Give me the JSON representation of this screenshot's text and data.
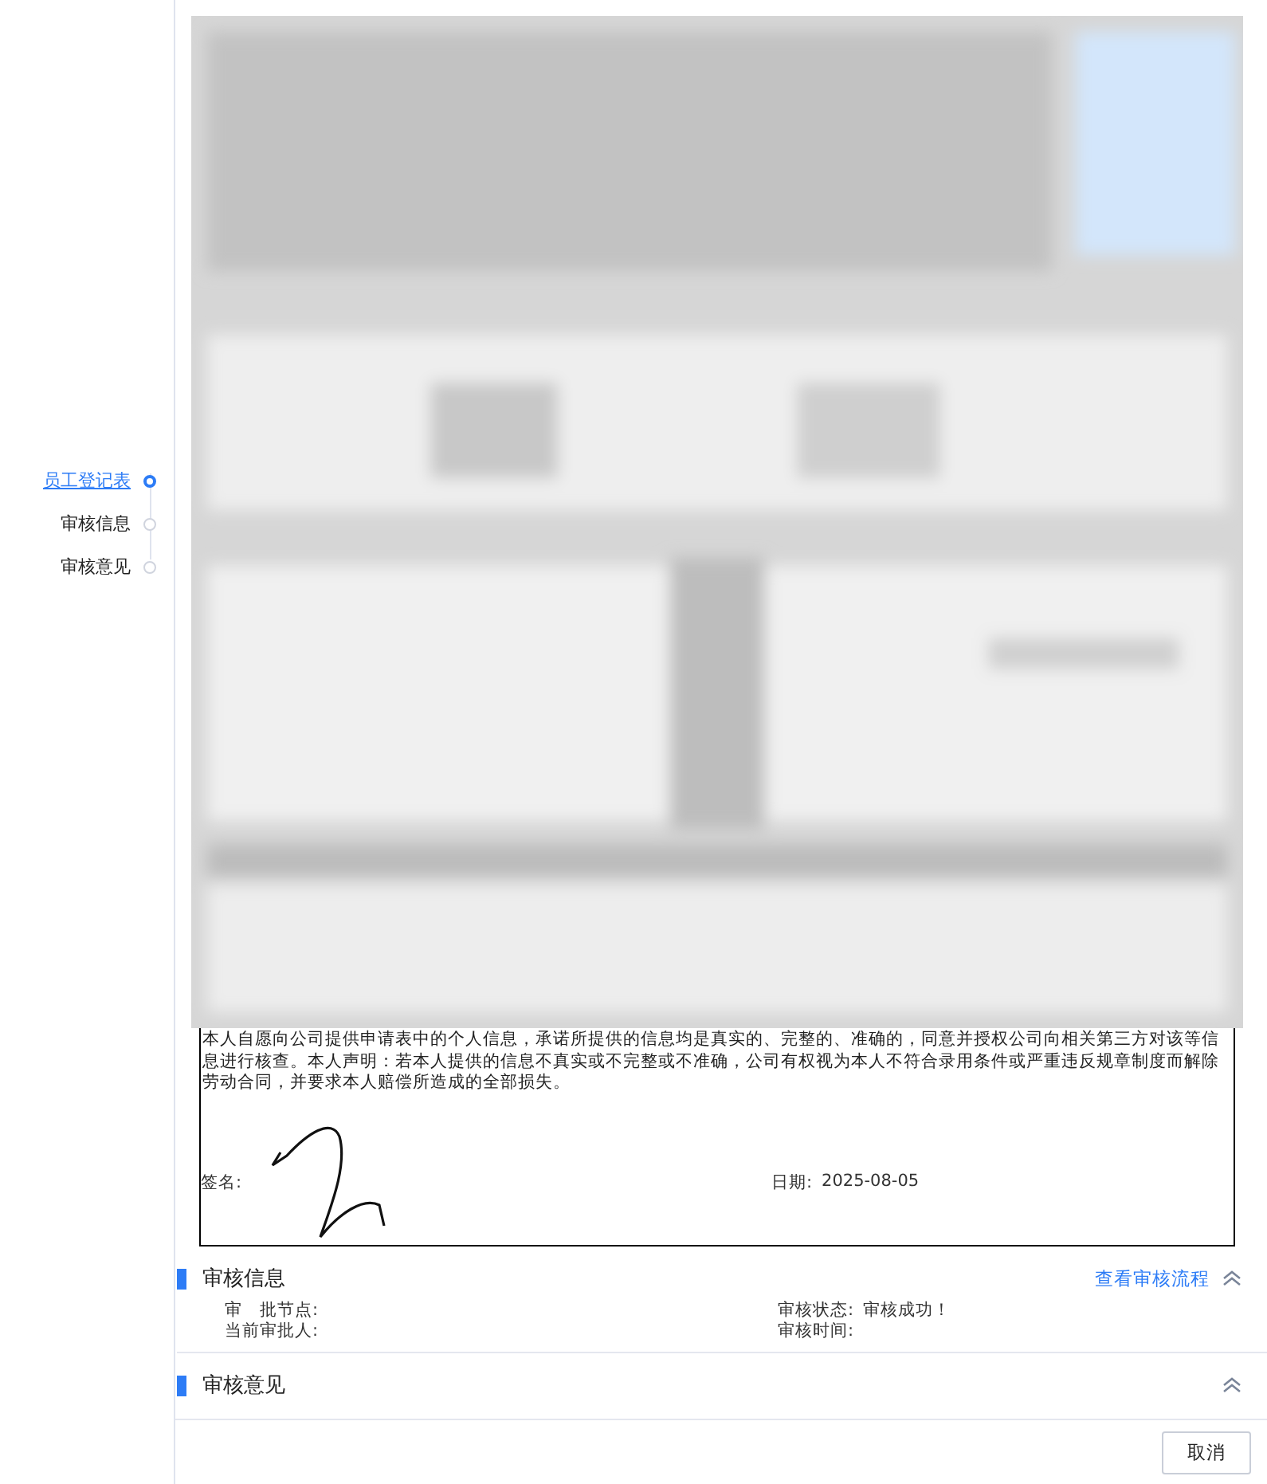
{
  "nav": {
    "items": [
      {
        "label": "员工登记表",
        "selected": true
      },
      {
        "label": "审核信息",
        "selected": false
      },
      {
        "label": "审核意见",
        "selected": false
      }
    ]
  },
  "declaration": {
    "text": "本人自愿向公司提供申请表中的个人信息，承诺所提供的信息均是真实的、完整的、准确的，同意并授权公司向相关第三方对该等信息进行核查。本人声明：若本人提供的信息不真实或不完整或不准确，公司有权视为本人不符合录用条件或严重违反规章制度而解除劳动合同，并要求本人赔偿所造成的全部损失。",
    "signature_label": "签名:",
    "date_label": "日期:",
    "date": "2025-08-05"
  },
  "audit_info": {
    "title": "审核信息",
    "link": "查看审核流程",
    "expanded": true,
    "fields": [
      {
        "label": "审　批节点:"
      },
      {
        "label": "审核状态:",
        "value": "审核成功！"
      },
      {
        "label": "当前审批人:"
      },
      {
        "label": "审核时间:"
      }
    ]
  },
  "audit_opinion": {
    "title": "审核意见",
    "expanded": true
  },
  "footer": {
    "buttons": [
      "取消"
    ]
  }
}
